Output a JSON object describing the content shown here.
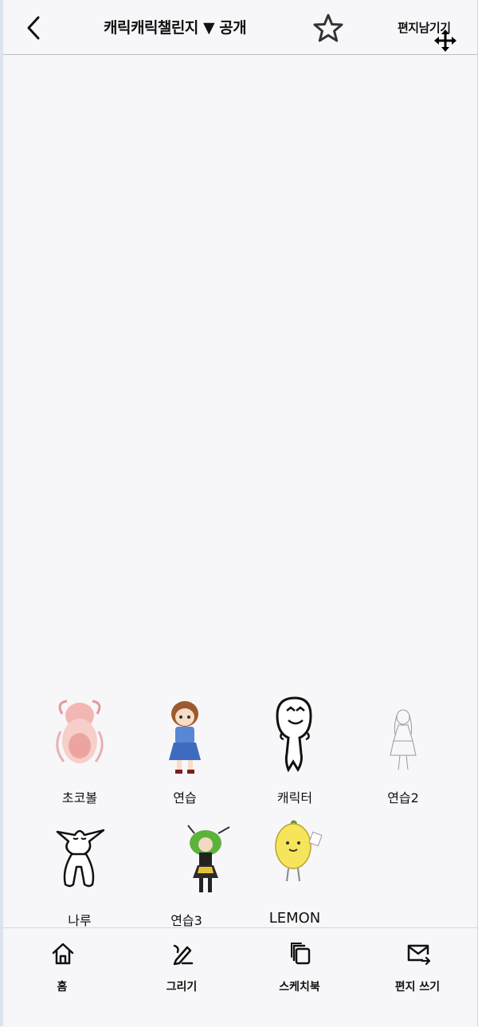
{
  "header": {
    "title": "캐릭캐릭챌린지 ▼ 공개",
    "guestbook_label": "편지남기기",
    "icons": [
      "back-icon",
      "star-icon",
      "move-cursor-icon"
    ]
  },
  "characters": [
    {
      "name": "초코볼",
      "icon": "pink-character-thumbnail"
    },
    {
      "name": "연습",
      "icon": "girl-uniform-thumbnail"
    },
    {
      "name": "캐릭터",
      "icon": "smiley-doodle-thumbnail"
    },
    {
      "name": "연습2",
      "icon": "sketch-girl-thumbnail"
    },
    {
      "name": "나루",
      "icon": "elf-doodle-thumbnail"
    },
    {
      "name": "연습3",
      "icon": "green-hair-girl-thumbnail"
    },
    {
      "name": "LEMON",
      "icon": "lemon-character-thumbnail"
    }
  ],
  "bottom_nav": [
    {
      "label": "홈",
      "icon": "home-icon"
    },
    {
      "label": "그리기",
      "icon": "pencil-icon"
    },
    {
      "label": "스케치북",
      "icon": "sketchbook-icon"
    },
    {
      "label": "편지 쓰기",
      "icon": "mail-send-icon"
    }
  ]
}
